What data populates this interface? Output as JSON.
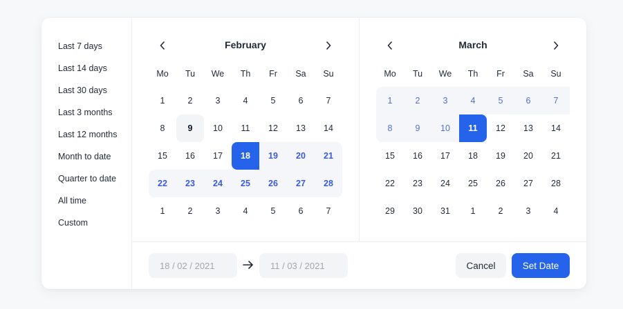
{
  "presets": [
    "Last 7 days",
    "Last 14 days",
    "Last 30 days",
    "Last 3 months",
    "Last 12 months",
    "Month to date",
    "Quarter to date",
    "All time",
    "Custom"
  ],
  "weekdays": [
    "Mo",
    "Tu",
    "We",
    "Th",
    "Fr",
    "Sa",
    "Su"
  ],
  "calendars": [
    {
      "month": "February",
      "prev_icon": "chevron-left-icon",
      "next_icon": "chevron-right-icon",
      "weeks": [
        [
          "1",
          "2",
          "3",
          "4",
          "5",
          "6",
          "7"
        ],
        [
          "8",
          "9",
          "10",
          "11",
          "12",
          "13",
          "14"
        ],
        [
          "15",
          "16",
          "17",
          "18",
          "19",
          "20",
          "21"
        ],
        [
          "22",
          "23",
          "24",
          "25",
          "26",
          "27",
          "28"
        ],
        [
          "1",
          "2",
          "3",
          "4",
          "5",
          "6",
          "7"
        ]
      ]
    },
    {
      "month": "March",
      "prev_icon": "chevron-left-icon",
      "next_icon": "chevron-right-icon",
      "weeks": [
        [
          "1",
          "2",
          "3",
          "4",
          "5",
          "6",
          "7"
        ],
        [
          "8",
          "9",
          "10",
          "11",
          "12",
          "13",
          "14"
        ],
        [
          "15",
          "16",
          "17",
          "18",
          "19",
          "20",
          "21"
        ],
        [
          "22",
          "23",
          "24",
          "25",
          "26",
          "27",
          "28"
        ],
        [
          "29",
          "30",
          "31",
          "1",
          "2",
          "3",
          "4"
        ]
      ]
    }
  ],
  "range": {
    "start": "18 / 02 / 2021",
    "end": "11 / 03 / 2021"
  },
  "footer": {
    "arrow_icon": "arrow-right-icon",
    "cancel_label": "Cancel",
    "set_label": "Set Date"
  },
  "colors": {
    "accent": "#2563eb",
    "range_bg": "#f4f6fa",
    "range_text": "#3b5bdb"
  }
}
